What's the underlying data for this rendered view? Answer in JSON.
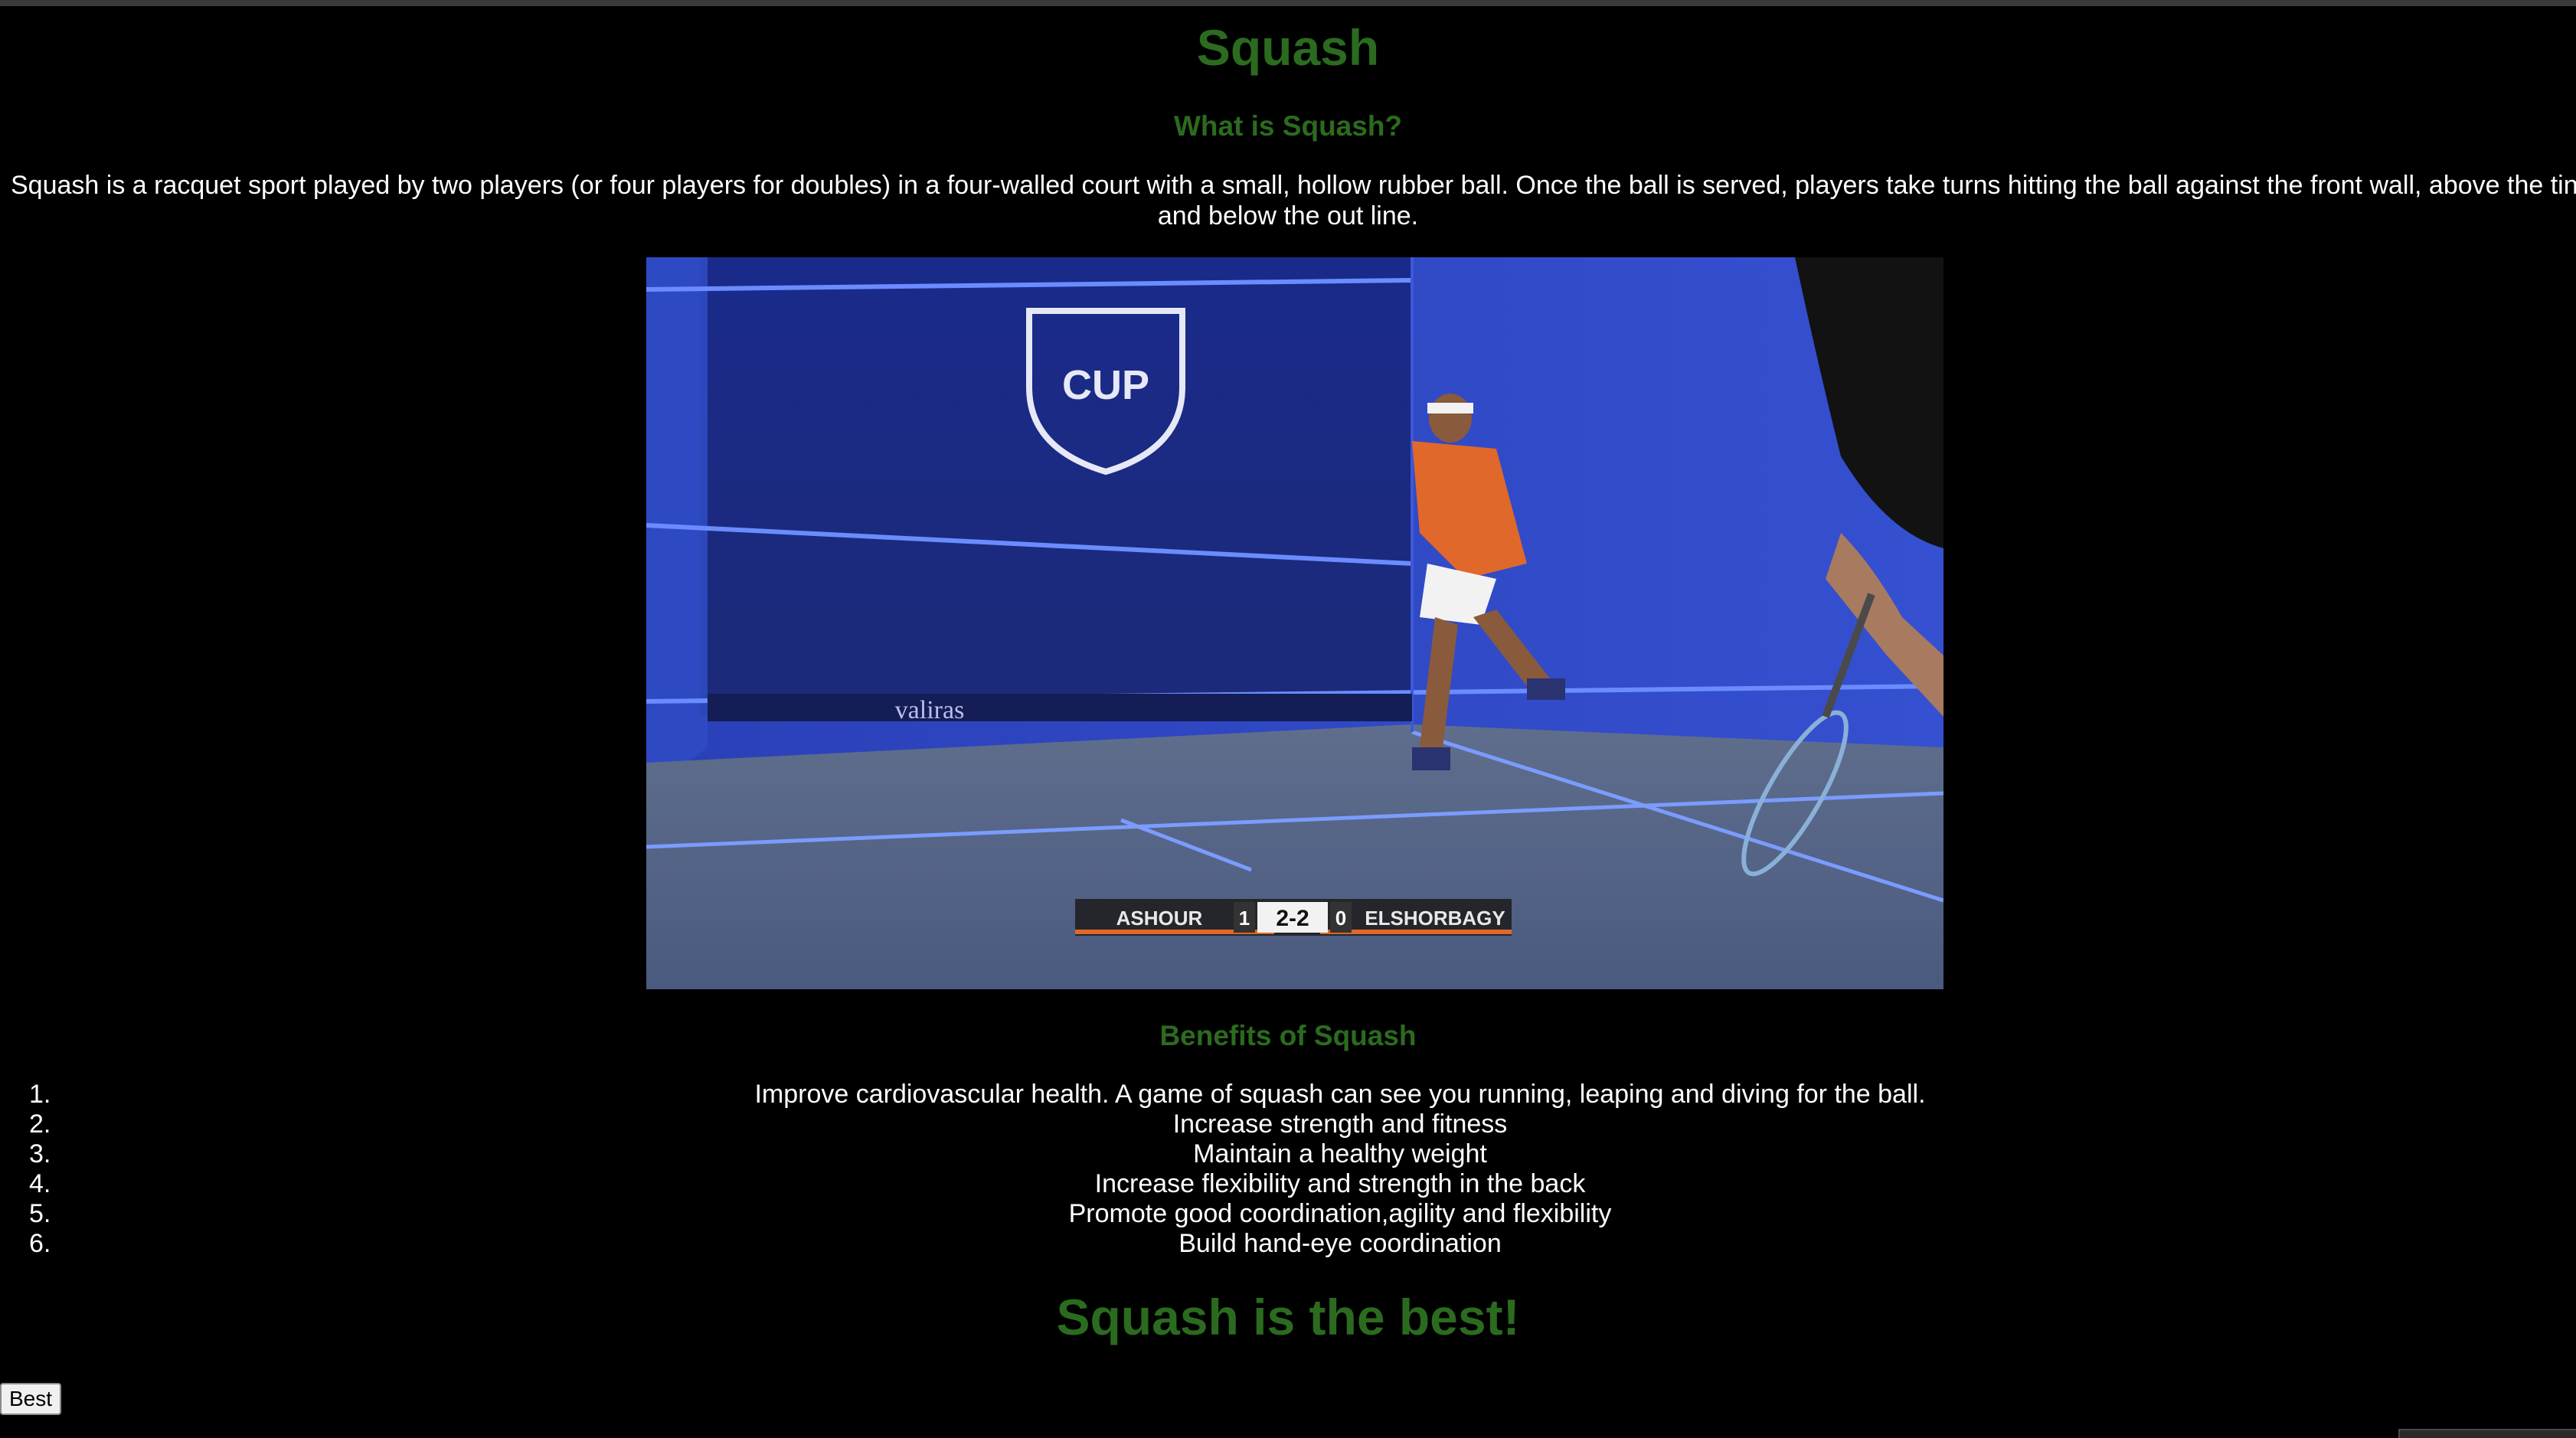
{
  "page": {
    "title": "Squash",
    "what_heading": "What is Squash?",
    "intro_line1": "Squash is a racquet sport played by two players (or four players for doubles) in a four-walled court with a small, hollow rubber ball. Once the ball is served, players take turns hitting the ball against the front wall, above the tin",
    "intro_line2": "and below the out line.",
    "benefits_heading": "Benefits of Squash",
    "benefits": [
      "Improve cardiovascular health. A game of squash can see you running, leaping and diving for the ball.",
      "Increase strength and fitness",
      "Maintain a healthy weight",
      "Increase flexibility and strength in the back",
      "Promote good coordination,agility and flexibility",
      "Build hand-eye coordination"
    ],
    "closing": "Squash is the best!",
    "best_button_label": "Best"
  },
  "photo": {
    "wall_text": "CUP",
    "sponsor_text": "valiras",
    "scoreboard": {
      "player_left": "ASHOUR",
      "games_left": "1",
      "score": "2-2",
      "games_right": "0",
      "player_right": "ELSHORBAGY"
    }
  },
  "colors": {
    "background": "#000000",
    "heading_green": "#2b6b1f",
    "text": "#ffffff",
    "court_blue": "#2436a0"
  }
}
